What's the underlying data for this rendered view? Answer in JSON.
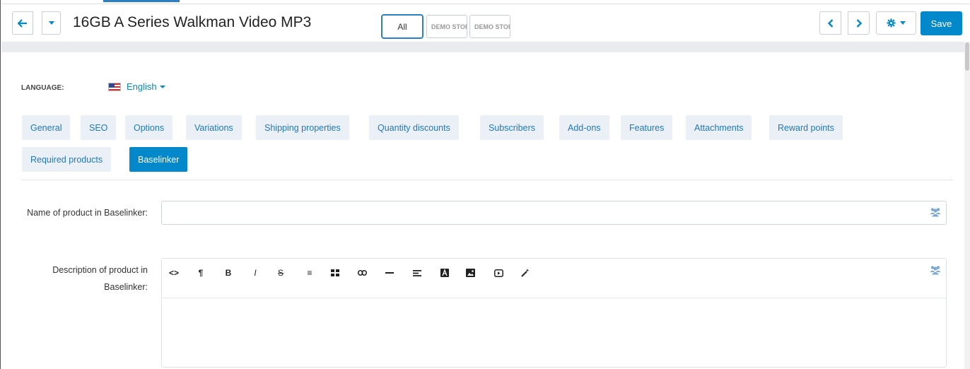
{
  "header": {
    "title": "16GB A Series Walkman Video MP3",
    "stores": {
      "all_label": "All",
      "demo_1": "DEMO STORE",
      "demo_2": "DEMO STORE"
    },
    "save_label": "Save",
    "icons": [
      "back-arrow-icon",
      "chevron-down-icon",
      "chevron-left-icon",
      "chevron-right-icon",
      "gear-icon",
      "users-icon"
    ]
  },
  "language": {
    "label": "LANGUAGE:",
    "value": "English"
  },
  "tabs": [
    {
      "label": "General"
    },
    {
      "label": "SEO"
    },
    {
      "label": "Options"
    },
    {
      "label": "Variations"
    },
    {
      "label": "Shipping properties"
    },
    {
      "label": "Quantity discounts"
    },
    {
      "label": "Subscribers"
    },
    {
      "label": "Add-ons"
    },
    {
      "label": "Features"
    },
    {
      "label": "Attachments"
    },
    {
      "label": "Reward points"
    },
    {
      "label": "Required products"
    },
    {
      "label": "Baselinker",
      "active": true
    }
  ],
  "fields": {
    "name_label": "Name of product in Baselinker:",
    "name_value": "",
    "description_label": "Description of product in Baselinker:",
    "description_value": ""
  },
  "editor_toolbar": [
    "code-view-icon",
    "paragraph-icon",
    "bold-icon",
    "italic-icon",
    "strikethrough-icon",
    "unordered-list-icon",
    "table-icon",
    "link-icon",
    "horizontal-rule-icon",
    "align-icon",
    "font-color-icon",
    "image-icon",
    "video-icon",
    "magic-wand-icon"
  ],
  "colors": {
    "accent": "#0388cc",
    "tab_bg": "#eaf0f6",
    "tab_text": "#1f78bc",
    "gray_bar": "#e9ebee"
  }
}
